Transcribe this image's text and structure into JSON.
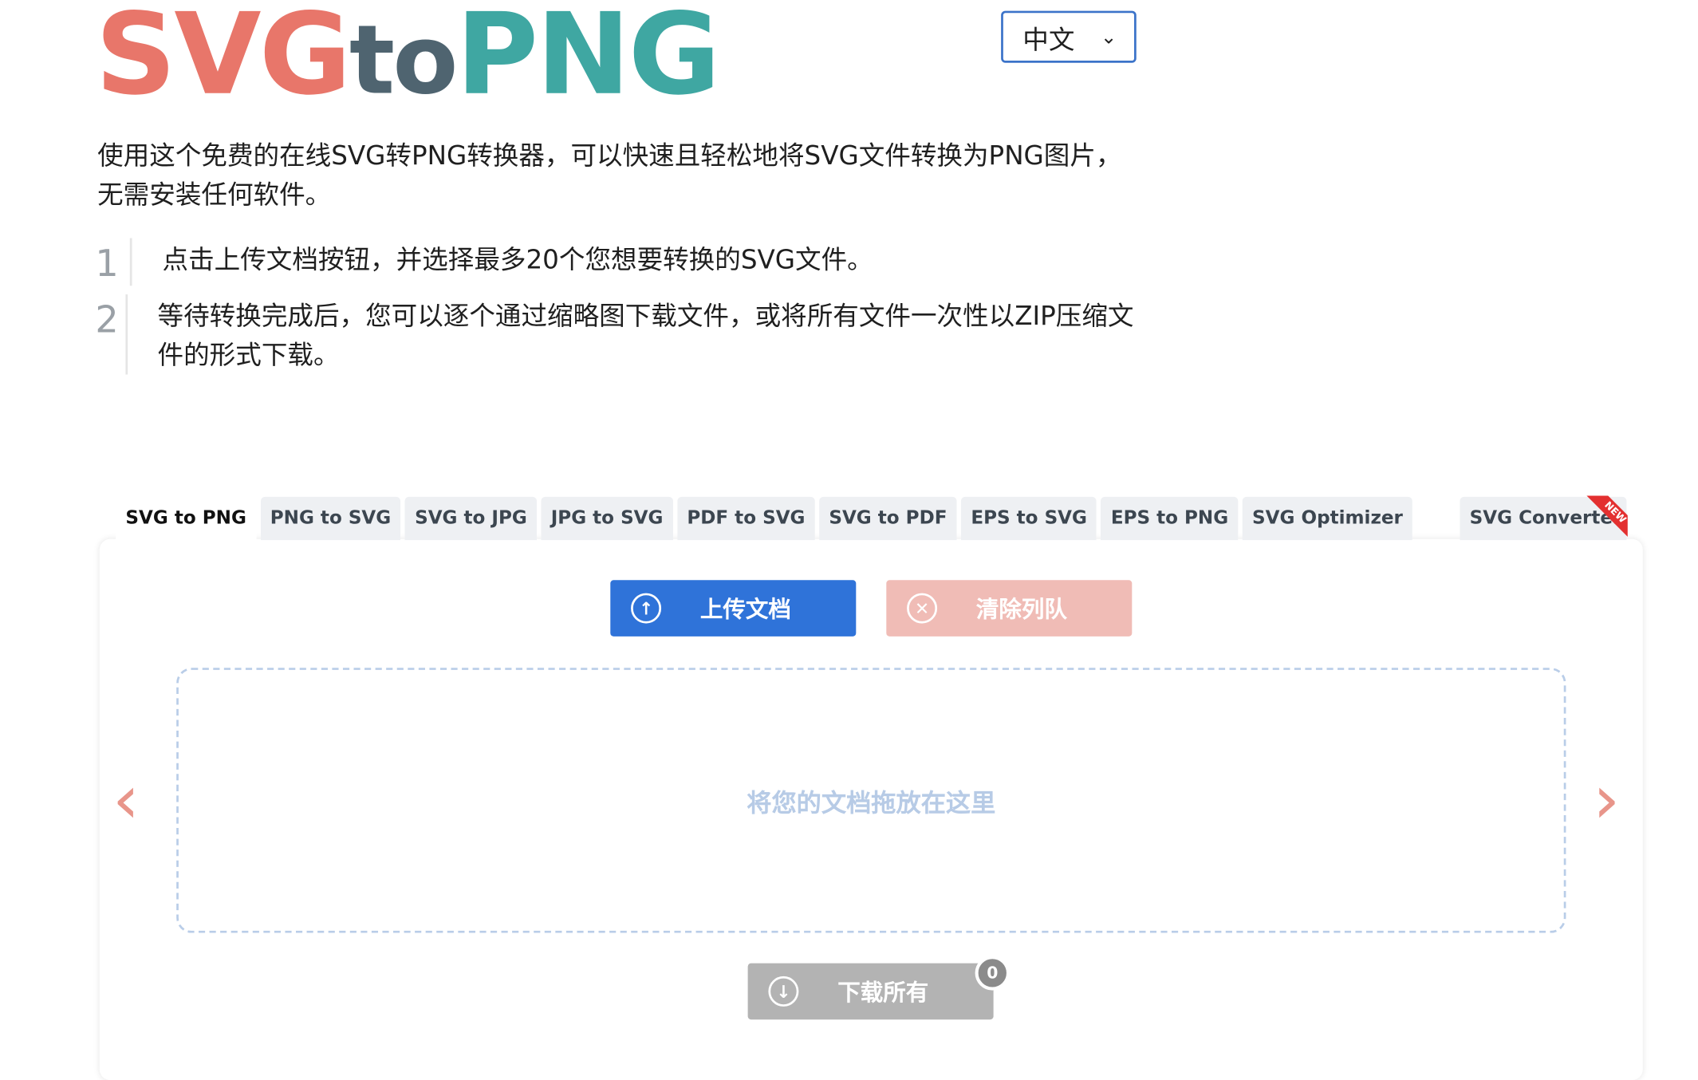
{
  "logo": {
    "part1": "SVG",
    "part2": "to",
    "part3": "PNG"
  },
  "language": {
    "selected": "中文"
  },
  "intro": "使用这个免费的在线SVG转PNG转换器，可以快速且轻松地将SVG文件转换为PNG图片，无需安装任何软件。",
  "steps": [
    {
      "num": "1",
      "text": "点击上传文档按钮，并选择最多20个您想要转换的SVG文件。"
    },
    {
      "num": "2",
      "text": "等待转换完成后，您可以逐个通过缩略图下载文件，或将所有文件一次性以ZIP压缩文件的形式下载。"
    }
  ],
  "tabs": [
    "SVG to PNG",
    "PNG to SVG",
    "SVG to JPG",
    "JPG to SVG",
    "PDF to SVG",
    "SVG to PDF",
    "EPS to SVG",
    "EPS to PNG",
    "SVG Optimizer"
  ],
  "tab_right": {
    "label": "SVG Converter",
    "ribbon": "NEW"
  },
  "buttons": {
    "upload": "上传文档",
    "clear": "清除列队",
    "download": "下载所有"
  },
  "dropzone": "将您的文档拖放在这里",
  "nav": {
    "prev": "‹",
    "next": "›"
  },
  "download_count": "0"
}
